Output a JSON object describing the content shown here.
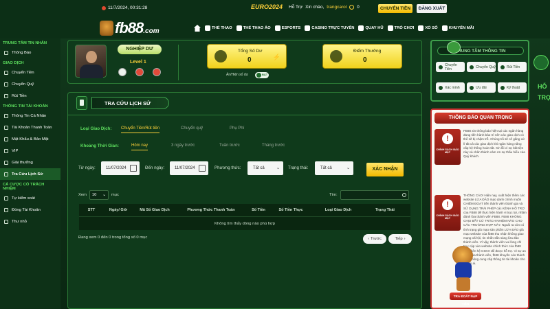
{
  "topbar": {
    "datetime": "11/7/2024, 00:31:28",
    "event": "EURO2024",
    "support": "Hỗ Trợ",
    "greeting": "Xin chào,",
    "username": "trangcarol",
    "notifications": "0",
    "deposit_label": "CHUYỂN TIỀN",
    "logout_label": "ĐĂNG XUẤT"
  },
  "logo": {
    "text": "fb88",
    "domain": ".com"
  },
  "nav": [
    {
      "label": "THỂ THAO"
    },
    {
      "label": "THỂ THAO ẢO"
    },
    {
      "label": "ESPORTS"
    },
    {
      "label": "CASINO TRỰC TUYẾN"
    },
    {
      "label": "QUAY HŨ"
    },
    {
      "label": "TRÒ CHƠI"
    },
    {
      "label": "XỔ SỐ"
    },
    {
      "label": "KHUYẾN MÃI"
    }
  ],
  "sidebar": {
    "sections": [
      {
        "title": "TRUNG TÂM TIN NHẮN",
        "items": [
          {
            "label": "Thông Báo"
          }
        ]
      },
      {
        "title": "GIAO DỊCH",
        "items": [
          {
            "label": "Chuyển Tiền"
          },
          {
            "label": "Chuyển Quỹ"
          },
          {
            "label": "Rút Tiền"
          }
        ]
      },
      {
        "title": "THÔNG TIN TÀI KHOẢN",
        "items": [
          {
            "label": "Thông Tin Cá Nhân"
          },
          {
            "label": "Tài Khoản Thanh Toán"
          },
          {
            "label": "Mật Khẩu & Bảo Mật"
          },
          {
            "label": "VIP"
          },
          {
            "label": "Giải thưởng"
          },
          {
            "label": "Tra Cứu Lịch Sử"
          }
        ]
      },
      {
        "title": "CÁ CƯỢC CÓ TRÁCH NHIỆM",
        "items": [
          {
            "label": "Tự kiểm soát"
          },
          {
            "label": "Đóng Tài Khoản"
          },
          {
            "label": "Thư nhỏ"
          }
        ]
      }
    ]
  },
  "profile": {
    "rank": "NGHIỆP DƯ",
    "level": "Level 1",
    "balance_label": "Tổng Số Dư",
    "balance_value": "0",
    "points_label": "Điểm Thưởng",
    "points_value": "0",
    "hide_label": "Ẩn/Hiện số dư",
    "toggle_text": "BẬT"
  },
  "history": {
    "title": "TRA CỨU LỊCH SỬ",
    "type_label": "Loại Giao Dịch:",
    "type_tabs": [
      "Chuyển Tiền/Rút tiền",
      "Chuyển quỹ",
      "Phụ Phí"
    ],
    "time_label": "Khoảng Thời Gian:",
    "time_tabs": [
      "Hôm nay",
      "3 ngày trước",
      "Tuần trước",
      "Tháng trước"
    ],
    "from_label": "Từ ngày:",
    "from_value": "11/07/2024",
    "to_label": "Đến ngày:",
    "to_value": "11/07/2024",
    "method_label": "Phương thức:",
    "method_value": "Tất cả",
    "status_label": "Trạng thái:",
    "status_value": "Tất cả",
    "confirm_label": "XÁC NHẬN",
    "show_prefix": "Xem",
    "show_value": "10",
    "show_suffix": "mục",
    "search_label": "Tìm:",
    "columns": [
      "STT",
      "Ngày/ Giờ",
      "Mã Số Giao Dịch",
      "Phương Thức Thanh Toán",
      "Số Tiền",
      "Số Tiền Thực",
      "Loại Giao Dịch",
      "Trạng Thái"
    ],
    "empty_text": "Không tìm thấy dòng nào phù hợp",
    "info_text": "Đang xem 0 đến 0 trong tổng số 0 mục",
    "prev_label": "Trước",
    "next_label": "Tiếp"
  },
  "right": {
    "center_title": "TRUNG TÂM THÔNG TIN",
    "center_buttons": [
      "Chuyển Tiền",
      "Chuyển Quỹ",
      "Rút Tiền",
      "Xác minh",
      "Ưu đãi",
      "Kỹ thuật"
    ],
    "notice_title": "THÔNG BÁO QUAN TRỌNG",
    "notice_img_label": "CHÍNH SÁCH BẢO MẬT",
    "notice1": "FB88 xin thông báo hiện tại các ngân hàng đang tiến hành bảo trì nên các giao dịch có thể sẽ bị chậm trễ. Chúng tôi sẽ cố gắng xử lí tất cả các giao dịch khi ngân hàng nâng cấp hệ thống hoàn tất. Xin lỗi vì sự bất tiện này và chân thành cảm ơn sự thấu hiểu của Quý khách.",
    "notice2": "THÔNG CÁO! Hiện nay, xuất hiện thêm các website LỪA ĐẢO mạo danh chính muốn CHIẾM ĐOẠT tiền thành viên thành gia và SỬ DỤNG TRÁI PHÉP các KÊNH HỖ TRỢ của FB88 để thực hiện hành vi trục lợi, nhằm đánh lừa thành viên FB88. FB88 KHÔNG CHỊU BẤT CỨ TRÁCH NHIỆM NÀO CHO CÁC TRƯỜNG HỢP NÀY. Ngoài ra còn có tình trạng giả mạo sản phẩm LỪA ĐẢO giả mạo website của fb88 thu nhận không giao mạng xã hội, tin nhắn sẵn sàng lừa đảo thành viên. Vì vậy, thành viên vui lòng chỉ truy cập vào website chính thức của fb88 hoặc liên hệ CSKH để được hỗ trợ. Vì sự an toàn của thành viên, fb88 khuyến cáo thành viên không cung cấp thông tin tài khoản cho bất kỳ ai.",
    "promo_badge": "TRA ĐOÁT NẠP TIỀN"
  },
  "support": {
    "label": "HỖ TRỢ"
  }
}
